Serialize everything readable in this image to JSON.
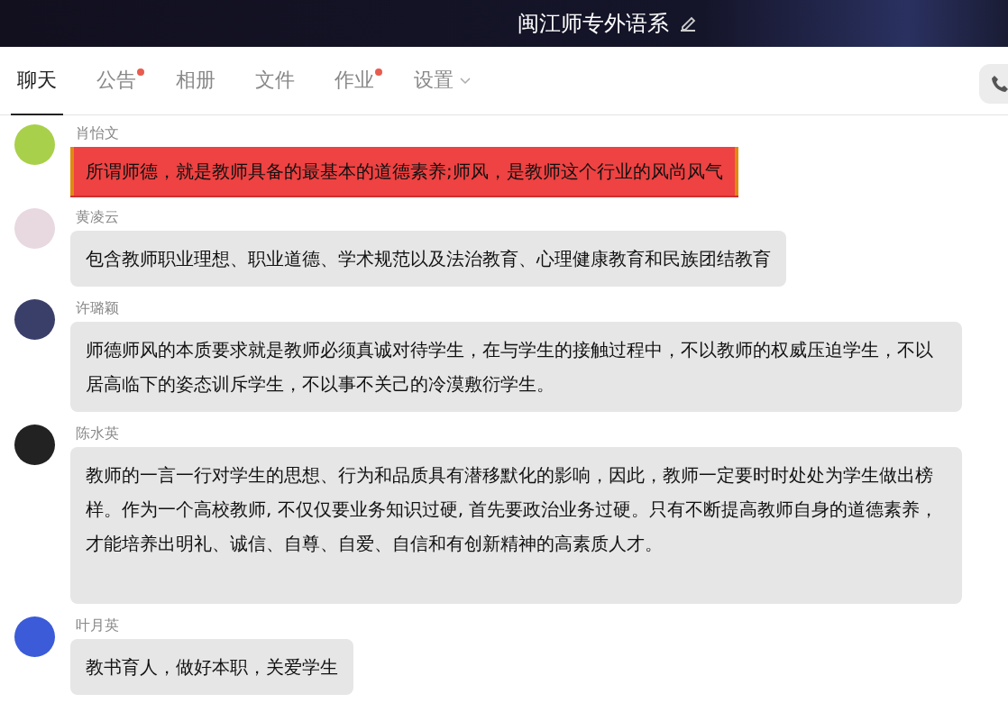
{
  "header": {
    "title": "闽江师专外语系"
  },
  "tabs": [
    {
      "label": "聊天",
      "selected": true,
      "has_dot": false,
      "kind": "tab"
    },
    {
      "label": "公告",
      "selected": false,
      "has_dot": true,
      "kind": "tab"
    },
    {
      "label": "相册",
      "selected": false,
      "has_dot": false,
      "kind": "tab"
    },
    {
      "label": "文件",
      "selected": false,
      "has_dot": false,
      "kind": "tab"
    },
    {
      "label": "作业",
      "selected": false,
      "has_dot": true,
      "kind": "tab"
    },
    {
      "label": "设置",
      "selected": false,
      "has_dot": false,
      "kind": "dropdown"
    }
  ],
  "messages": [
    {
      "sender": "肖怡文",
      "color": "#a8d04a",
      "kind": "banner",
      "text": "所谓师德，就是教师具备的最基本的道德素养;师风，是教师这个行业的风尚风气"
    },
    {
      "sender": "黄凌云",
      "color": "#e8d8e0",
      "kind": "bubble",
      "text": "包含教师职业理想、职业道德、学术规范以及法治教育、心理健康教育和民族团结教育"
    },
    {
      "sender": "许璐颖",
      "color": "#3a3f6a",
      "kind": "bubble",
      "text": "师德师风的本质要求就是教师必须真诚对待学生，在与学生的接触过程中，不以教师的权威压迫学生，不以居高临下的姿态训斥学生，不以事不关己的冷漠敷衍学生。"
    },
    {
      "sender": "陈水英",
      "color": "#222222",
      "kind": "bubble",
      "text": "教师的一言一行对学生的思想、行为和品质具有潜移默化的影响，因此，教师一定要时时处处为学生做出榜样。作为一个高校教师, 不仅仅要业务知识过硬, 首先要政治业务过硬。只有不断提高教师自身的道德素养，才能培养出明礼、诚信、自尊、自爱、自信和有创新精神的高素质人才。"
    },
    {
      "sender": "叶月英",
      "color": "#3b5bd8",
      "kind": "bubble",
      "text": "教书育人，做好本职，关爱学生"
    }
  ]
}
